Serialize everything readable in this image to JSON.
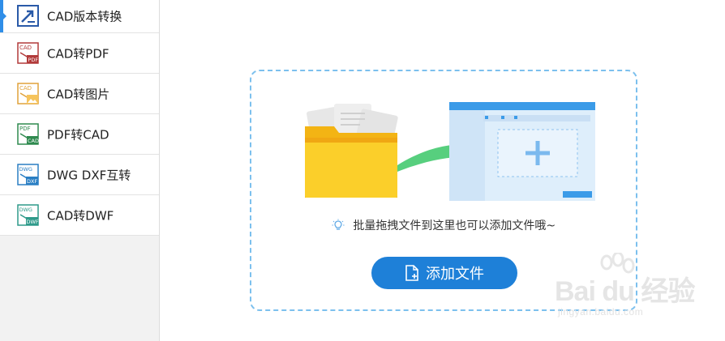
{
  "sidebar": {
    "items": [
      {
        "label": "CAD版本转换",
        "icon": "cad-version-convert-icon",
        "active": true
      },
      {
        "label": "CAD转PDF",
        "icon": "cad-to-pdf-icon"
      },
      {
        "label": "CAD转图片",
        "icon": "cad-to-image-icon"
      },
      {
        "label": "PDF转CAD",
        "icon": "pdf-to-cad-icon"
      },
      {
        "label": "DWG DXF互转",
        "icon": "dwg-dxf-convert-icon"
      },
      {
        "label": "CAD转DWF",
        "icon": "cad-to-dwf-icon"
      }
    ],
    "icon_texts": {
      "cad": "CAD",
      "pdf": "PDF",
      "dwg": "DWG",
      "dxf": "DXF",
      "dwf": "DWF"
    }
  },
  "dropzone": {
    "hint": "批量拖拽文件到这里也可以添加文件哦~",
    "add_button_label": "添加文件"
  },
  "watermark": {
    "logo": "Bai du 经验",
    "sub": "jingyan.baidu.com"
  },
  "colors": {
    "accent": "#2f8ee8",
    "button": "#1e80d8",
    "dashed_border": "#7cc0ee",
    "folder": "#f7c21a",
    "arrow": "#57cf7e"
  }
}
